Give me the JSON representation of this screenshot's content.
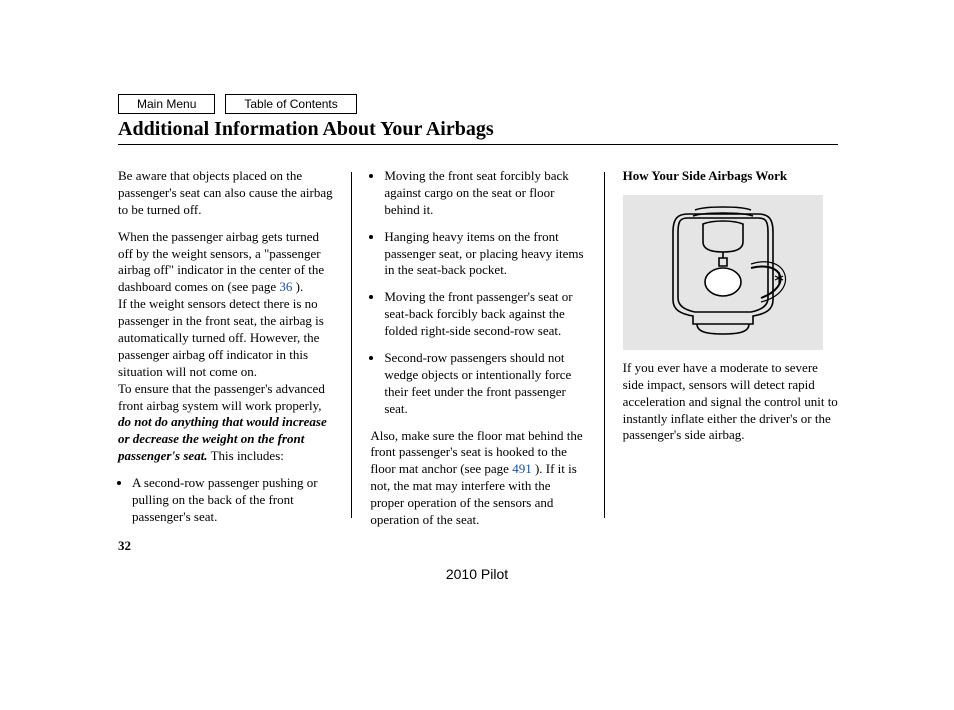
{
  "nav": {
    "main_menu": "Main Menu",
    "toc": "Table of Contents"
  },
  "heading": "Additional Information About Your Airbags",
  "col1": {
    "p1": "Be aware that objects placed on the passenger's seat can also cause the airbag to be turned off.",
    "p2a": "When the passenger airbag gets turned off by the weight sensors, a \"passenger airbag off\" indicator in the center of the dashboard comes on (see page ",
    "p2link": "36",
    "p2b": " ).",
    "p3": "If the weight sensors detect there is no passenger in the front seat, the airbag is automatically turned off. However, the passenger airbag off indicator in this situation will not come on.",
    "p4a": "To ensure that the passenger's advanced front airbag system will work properly, ",
    "p4b": "do not do anything that would increase or decrease the weight on the front passenger's seat.",
    "p4c": " This includes:",
    "li1": "A second-row passenger pushing or pulling on the back of the front passenger's seat."
  },
  "col2": {
    "li1": "Moving the front seat forcibly back against cargo on the seat or floor behind it.",
    "li2": "Hanging heavy items on the front passenger seat, or placing heavy items in the seat-back pocket.",
    "li3": "Moving the front passenger's seat or seat-back forcibly back against the folded right-side second-row seat.",
    "li4": "Second-row passengers should not wedge objects or intentionally force their feet under the front passenger seat.",
    "p1a": "Also, make sure the floor mat behind the front passenger's seat is hooked to the floor mat anchor (see page ",
    "p1link": "491",
    "p1b": " ). If it is not, the mat may interfere with the proper operation of the sensors and operation of the seat."
  },
  "col3": {
    "heading": "How Your Side Airbags Work",
    "p1": "If you ever have a moderate to severe side impact, sensors will detect rapid acceleration and signal the control unit to instantly inflate either the driver's or the passenger's side airbag."
  },
  "page_number": "32",
  "model_year": "2010 Pilot"
}
